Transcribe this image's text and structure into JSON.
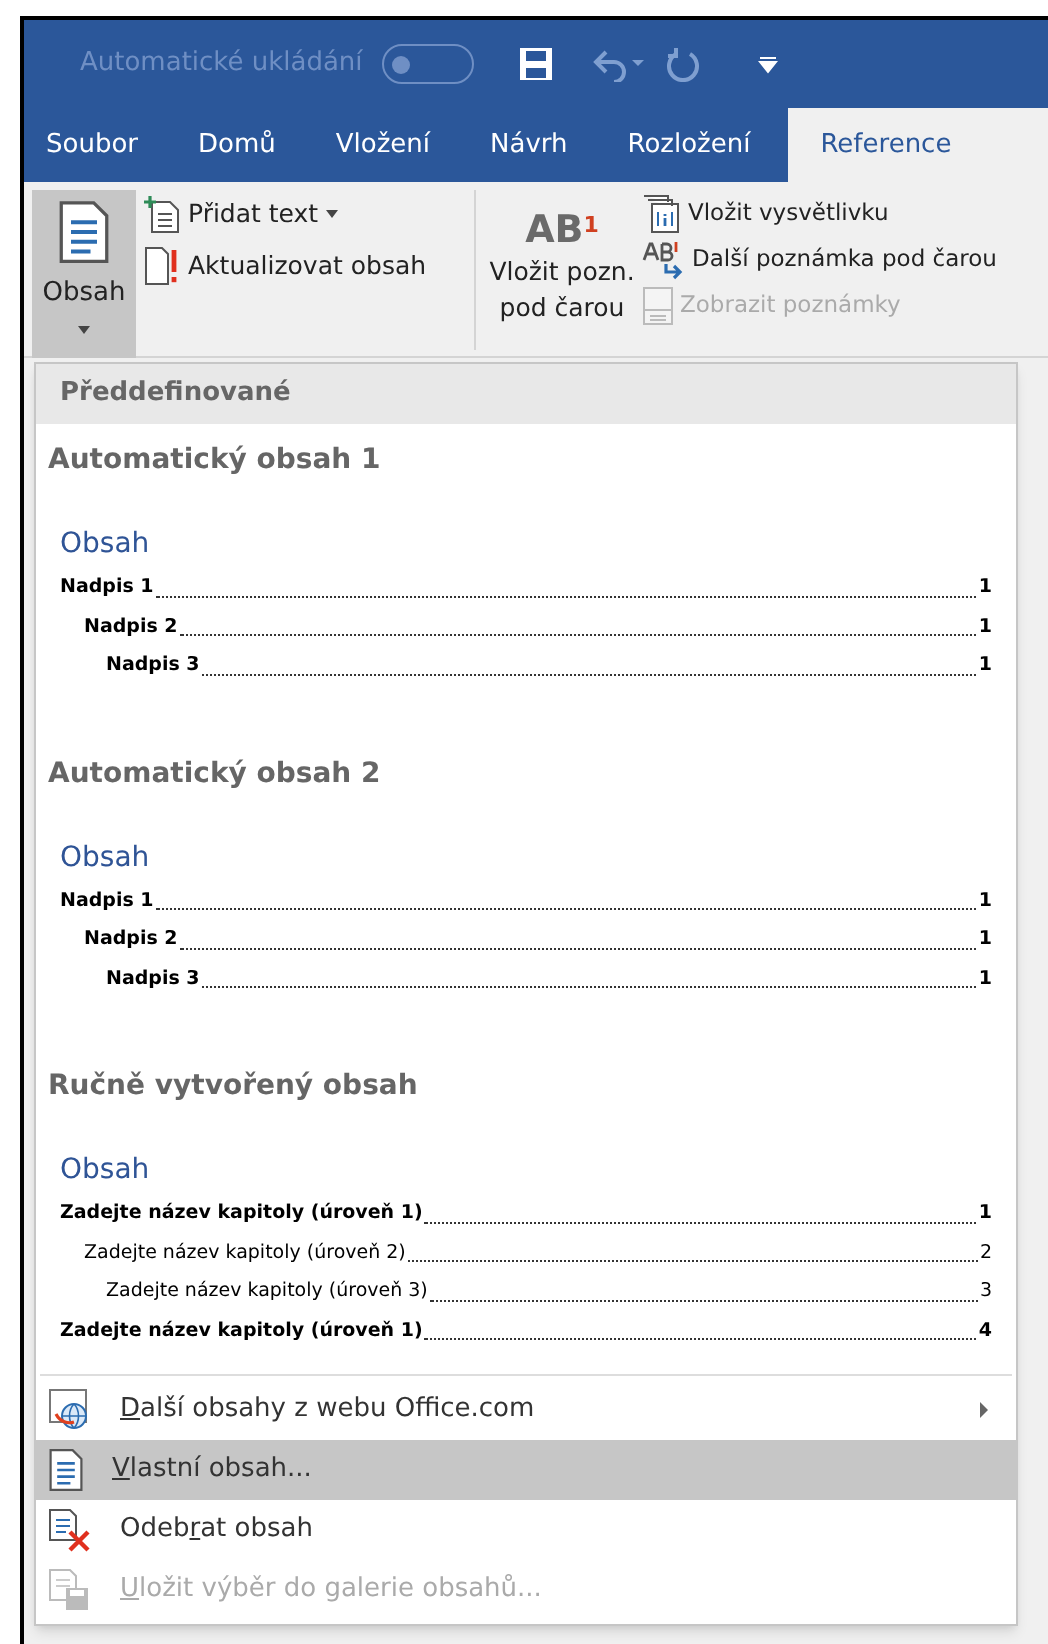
{
  "quick_access": {
    "autosave_label": "Automatické ukládání",
    "autosave_on": false
  },
  "tabs": [
    {
      "label": "Soubor",
      "selected": false
    },
    {
      "label": "Domů",
      "selected": false
    },
    {
      "label": "Vložení",
      "selected": false
    },
    {
      "label": "Návrh",
      "selected": false
    },
    {
      "label": "Rozložení",
      "selected": false
    },
    {
      "label": "Reference",
      "selected": true
    }
  ],
  "ribbon": {
    "toc_button": {
      "label": "Obsah",
      "pressed": true
    },
    "toc_commands": [
      {
        "label": "Přidat text",
        "kind": "add",
        "dropdown": true
      },
      {
        "label": "Aktualizovat obsah",
        "kind": "update",
        "dropdown": false
      }
    ],
    "footnote_button": {
      "icon_text": "AB",
      "icon_sup": "1",
      "label_lines": [
        "Vložit pozn.",
        "pod čarou"
      ]
    },
    "footnote_commands": [
      {
        "label": "Vložit vysvětlivku",
        "kind": "endnote",
        "disabled": false
      },
      {
        "label": "Další poznámka pod čarou",
        "kind": "next",
        "disabled": false
      },
      {
        "label": "Zobrazit poznámky",
        "kind": "show",
        "disabled": true
      }
    ]
  },
  "dropdown": {
    "section_header": "Předdefinované",
    "gallery": [
      {
        "title": "Automatický obsah 1",
        "heading": "Obsah",
        "entries": [
          {
            "text": "Nadpis 1",
            "page": "1",
            "bold": true,
            "children": [
              {
                "text": "Nadpis 2",
                "page": "1",
                "bold": true,
                "children": [
                  {
                    "text": "Nadpis 3",
                    "page": "1",
                    "bold": true
                  }
                ]
              }
            ]
          }
        ]
      },
      {
        "title": "Automatický obsah 2",
        "heading": "Obsah",
        "entries": [
          {
            "text": "Nadpis 1",
            "page": "1",
            "bold": true,
            "children": [
              {
                "text": "Nadpis 2",
                "page": "1",
                "bold": true,
                "children": [
                  {
                    "text": "Nadpis 3",
                    "page": "1",
                    "bold": true
                  }
                ]
              }
            ]
          }
        ]
      },
      {
        "title": "Ručně vytvořený obsah",
        "heading": "Obsah",
        "entries": [
          {
            "text": "Zadejte název kapitoly (úroveň 1)",
            "page": "1",
            "bold": true,
            "children": [
              {
                "text": "Zadejte název kapitoly (úroveň 2)",
                "page": "2",
                "bold": false,
                "children": [
                  {
                    "text": "Zadejte název kapitoly (úroveň 3)",
                    "page": "3",
                    "bold": false
                  }
                ]
              }
            ]
          },
          {
            "text": "Zadejte název kapitoly (úroveň 1)",
            "page": "4",
            "bold": true
          }
        ]
      }
    ],
    "menu": [
      {
        "kind": "web",
        "label": {
          "key": "D",
          "after": "alší obsahy z webu Office.com"
        },
        "submenu": true,
        "selected": false,
        "disabled": false
      },
      {
        "kind": "custom",
        "label": {
          "key": "V",
          "after": "lastní obsah..."
        },
        "submenu": false,
        "selected": true,
        "disabled": false
      },
      {
        "kind": "remove",
        "label": {
          "before": "Odeb",
          "key": "r",
          "after": "at obsah"
        },
        "submenu": false,
        "selected": false,
        "disabled": false
      },
      {
        "kind": "save",
        "label": {
          "key": "U",
          "after": "ložit výběr do galerie obsahů..."
        },
        "submenu": false,
        "selected": false,
        "disabled": true
      }
    ]
  }
}
